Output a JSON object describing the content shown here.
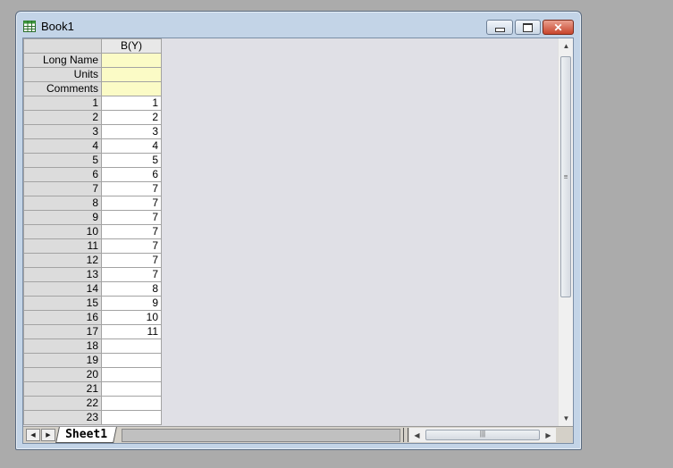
{
  "window": {
    "title": "Book1",
    "icons": {
      "app": "workbook-icon",
      "minimize": "minimize-icon",
      "maximize": "maximize-icon",
      "close": "close-icon"
    },
    "close_glyph": "✕"
  },
  "sheet": {
    "column_header": "B(Y)",
    "meta_rows": [
      "Long Name",
      "Units",
      "Comments"
    ],
    "rows": [
      {
        "n": "1",
        "v": "1"
      },
      {
        "n": "2",
        "v": "2"
      },
      {
        "n": "3",
        "v": "3"
      },
      {
        "n": "4",
        "v": "4"
      },
      {
        "n": "5",
        "v": "5"
      },
      {
        "n": "6",
        "v": "6"
      },
      {
        "n": "7",
        "v": "7"
      },
      {
        "n": "8",
        "v": "7"
      },
      {
        "n": "9",
        "v": "7"
      },
      {
        "n": "10",
        "v": "7"
      },
      {
        "n": "11",
        "v": "7"
      },
      {
        "n": "12",
        "v": "7"
      },
      {
        "n": "13",
        "v": "7"
      },
      {
        "n": "14",
        "v": "8"
      },
      {
        "n": "15",
        "v": "9"
      },
      {
        "n": "16",
        "v": "10"
      },
      {
        "n": "17",
        "v": "11"
      },
      {
        "n": "18",
        "v": ""
      },
      {
        "n": "19",
        "v": ""
      },
      {
        "n": "20",
        "v": ""
      },
      {
        "n": "21",
        "v": ""
      },
      {
        "n": "22",
        "v": ""
      },
      {
        "n": "23",
        "v": ""
      }
    ]
  },
  "tabs": {
    "active": "Sheet1"
  },
  "scrollbars": {
    "up": "▲",
    "down": "▼",
    "left": "◀",
    "right": "▶",
    "grip_v": "≡",
    "grip_h": "|||"
  }
}
